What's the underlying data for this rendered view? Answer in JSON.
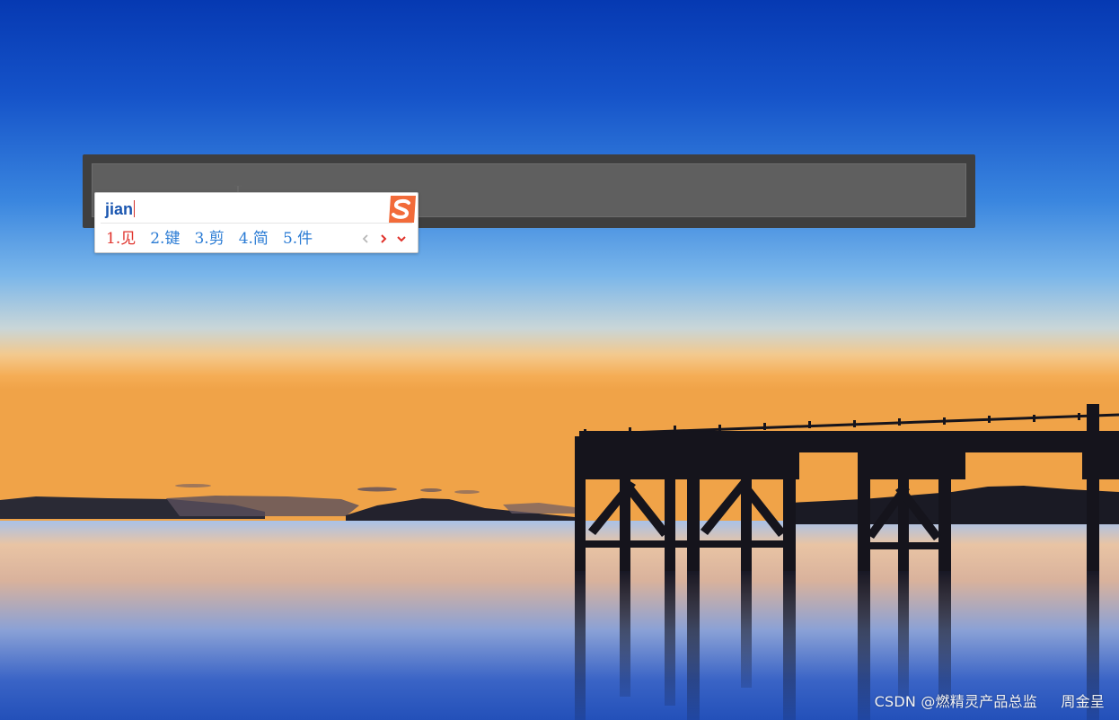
{
  "launcher": {
    "input_value": ""
  },
  "ime": {
    "composition": "jian",
    "candidates": [
      {
        "label": "1.见",
        "selected": true
      },
      {
        "label": "2.键",
        "selected": false
      },
      {
        "label": "3.剪",
        "selected": false
      },
      {
        "label": "4.简",
        "selected": false
      },
      {
        "label": "5.件",
        "selected": false
      }
    ],
    "logo_icon": "sogou-s-logo-icon",
    "nav_icons": [
      "chevron-left-icon",
      "chevron-right-icon",
      "chevron-down-icon"
    ]
  },
  "watermark": {
    "text": "CSDN @燃精灵产品总监     周金呈"
  },
  "colors": {
    "sky_top": "#0a3fb8",
    "sky_mid": "#3f86e0",
    "horizon_glow": "#f6b15a",
    "launcher_frame": "#3f3f3f",
    "launcher_input": "#5f5f5f",
    "candidate_selected": "#e0322b",
    "candidate_normal": "#2a7bd4",
    "composition_text": "#1a56b0",
    "logo_orange": "#f26b3a"
  }
}
